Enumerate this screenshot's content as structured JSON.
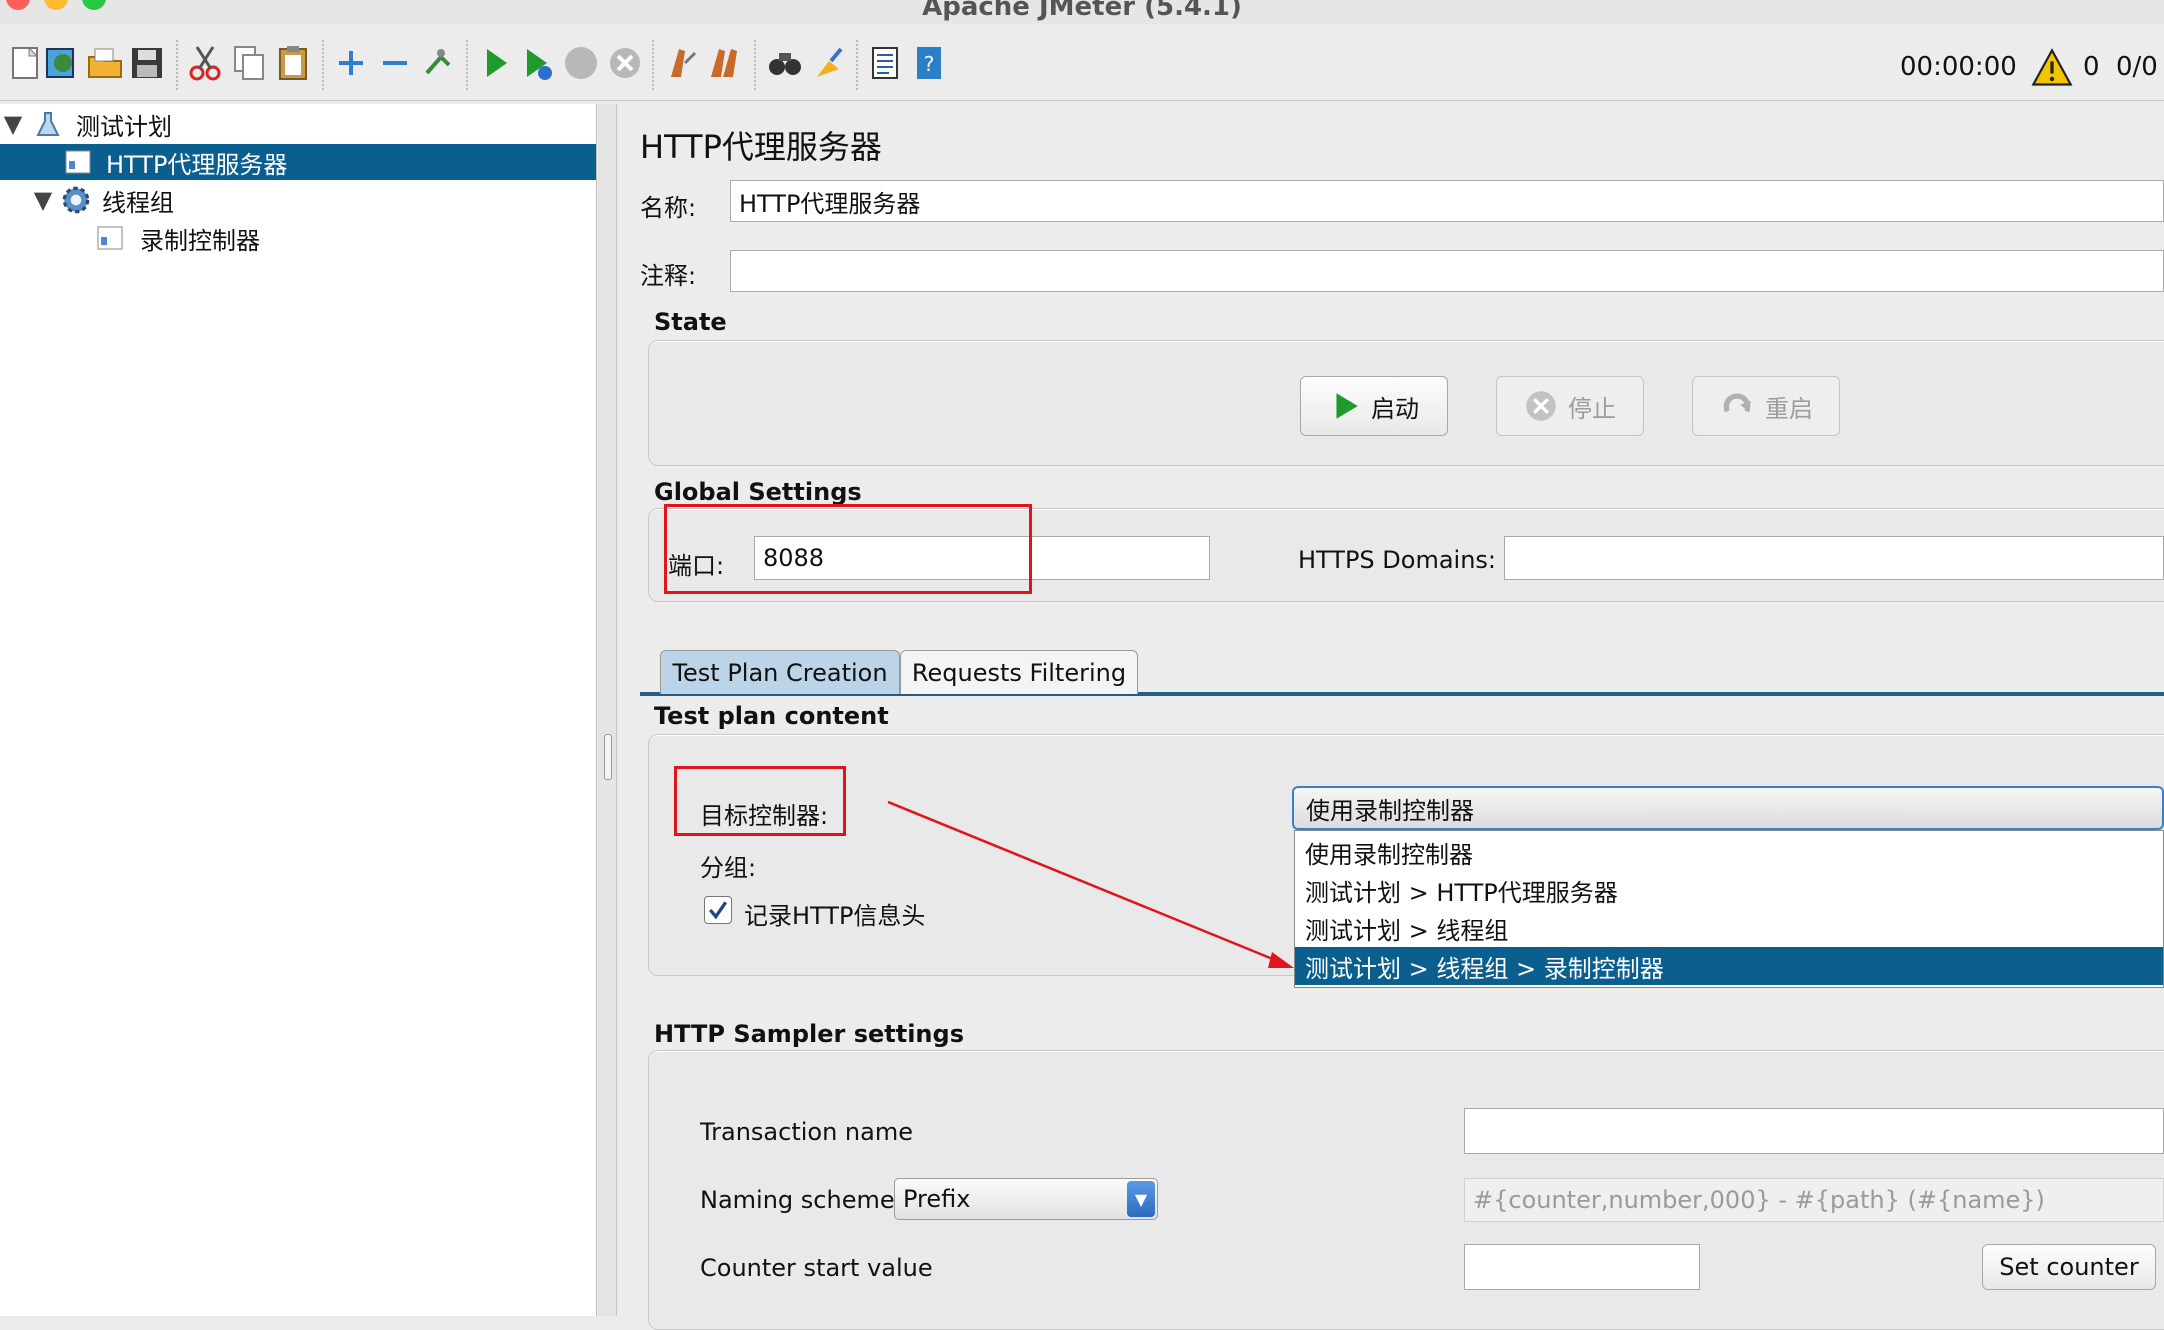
{
  "window": {
    "title": "Apache JMeter (5.4.1)"
  },
  "toolbar": {
    "icons": [
      "new-icon",
      "templates-icon",
      "open-icon",
      "save-icon",
      "cut-icon",
      "copy-icon",
      "paste-icon",
      "expand-icon",
      "collapse-icon",
      "toggle-icon",
      "start-icon",
      "start-no-pause-icon",
      "stop-icon",
      "shutdown-icon",
      "clear-icon",
      "clear-all-icon",
      "search-icon",
      "reset-search-icon",
      "function-helper-icon",
      "help-icon"
    ],
    "timer": "00:00:00",
    "warning_count": "0",
    "threads": "0/0"
  },
  "tree": {
    "items": [
      {
        "label": "测试计划",
        "icon": "test-plan-icon"
      },
      {
        "label": "HTTP代理服务器",
        "icon": "proxy-icon"
      },
      {
        "label": "线程组",
        "icon": "thread-group-icon"
      },
      {
        "label": "录制控制器",
        "icon": "controller-icon"
      }
    ]
  },
  "panel": {
    "title": "HTTP代理服务器",
    "name_label": "名称:",
    "name_value": "HTTP代理服务器",
    "comment_label": "注释:",
    "comment_value": "",
    "state": {
      "heading": "State",
      "start_label": "启动",
      "stop_label": "停止",
      "restart_label": "重启"
    },
    "global": {
      "heading": "Global Settings",
      "port_label": "端口:",
      "port_value": "8088",
      "https_label": "HTTPS Domains:",
      "https_value": ""
    },
    "tabs": [
      {
        "label": "Test Plan Creation",
        "selected": true
      },
      {
        "label": "Requests Filtering",
        "selected": false
      }
    ],
    "content": {
      "heading": "Test plan content",
      "target_label": "目标控制器:",
      "grouping_label": "分组:",
      "record_headers_label": "记录HTTP信息头",
      "record_headers_checked": true,
      "target_selected": "使用录制控制器",
      "target_options": [
        "使用录制控制器",
        "测试计划 > HTTP代理服务器",
        "测试计划 > 线程组",
        "测试计划 > 线程组 > 录制控制器"
      ],
      "highlighted_option": 3
    },
    "sampler": {
      "heading": "HTTP Sampler settings",
      "transaction_label": "Transaction name",
      "transaction_value": "",
      "naming_label": "Naming scheme",
      "naming_value": "Prefix",
      "naming_format": "#{counter,number,000} - #{path} (#{name})",
      "counter_label": "Counter start value",
      "counter_value": "",
      "set_counter_label": "Set counter"
    }
  },
  "colors": {
    "selection": "#0a5f8e",
    "annotation_red": "#e0141a"
  }
}
